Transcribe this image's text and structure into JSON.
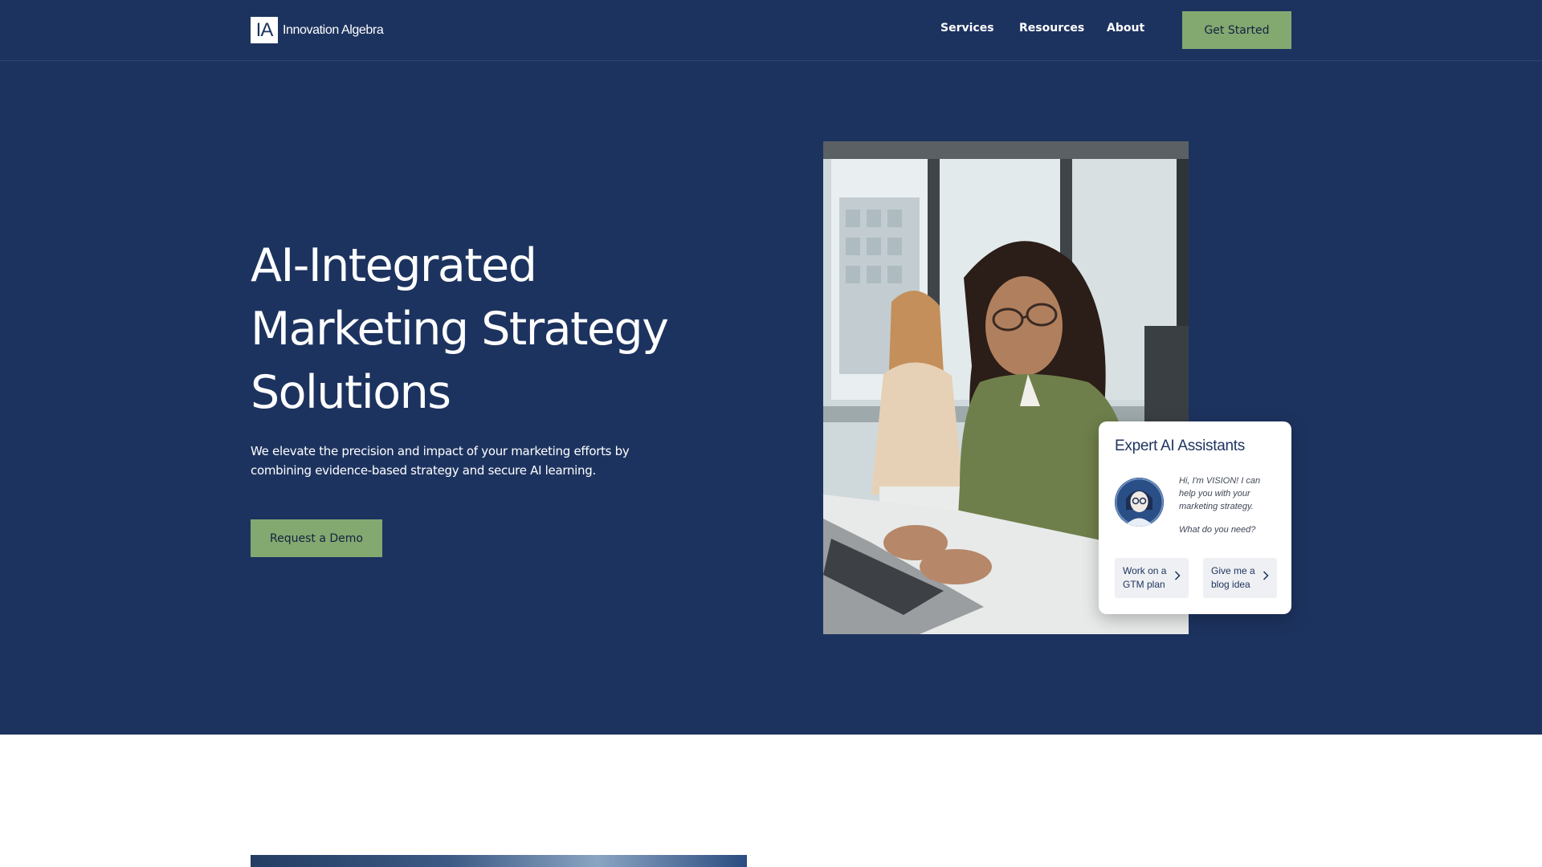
{
  "brand": {
    "logo_mark": "IA",
    "name": "Innovation Algebra"
  },
  "nav": {
    "items": [
      "Services",
      "Resources",
      "About"
    ],
    "cta_label": "Get Started"
  },
  "hero": {
    "headline_lines": [
      "AI-Integrated",
      "Marketing Strategy",
      "Solutions"
    ],
    "subtext": "We elevate the precision and impact of your marketing efforts by combining evidence-based strategy and secure AI learning.",
    "cta_label": "Request a Demo"
  },
  "chat_widget": {
    "title": "Expert AI Assistants",
    "message": "Hi, I'm VISION! I can help you with your marketing strategy.",
    "question": "What do you need?",
    "chips": [
      {
        "label": "Work on a GTM plan",
        "icon": "chevron-right-icon"
      },
      {
        "label": "Give me a blog idea",
        "icon": "chevron-right-icon"
      }
    ]
  },
  "colors": {
    "hero_background": "#1d335f",
    "accent_green": "#83a870",
    "text_white": "#ffffff",
    "card_background": "#ffffff"
  }
}
